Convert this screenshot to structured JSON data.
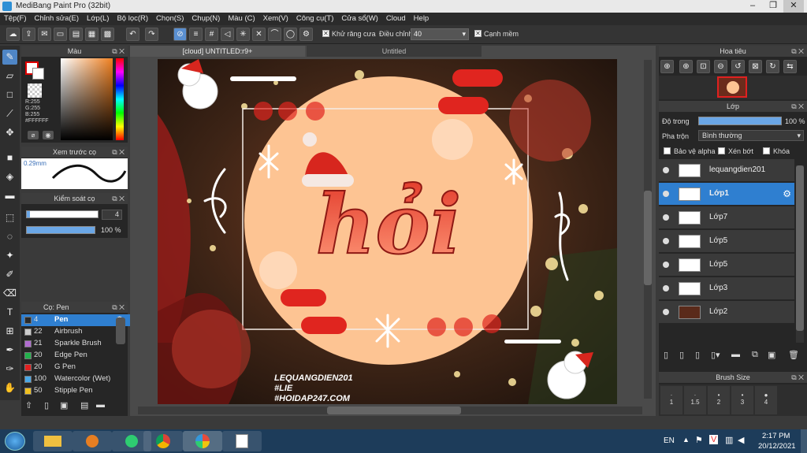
{
  "window": {
    "title": "MediBang Paint Pro (32bit)"
  },
  "menu": [
    "Tệp(F)",
    "Chỉnh sửa(E)",
    "Lớp(L)",
    "Bộ lọc(R)",
    "Chọn(S)",
    "Chụp(N)",
    "Màu (C)",
    "Xem(V)",
    "Công cụ(T)",
    "Cửa sổ(W)",
    "Cloud",
    "Help"
  ],
  "toolbar": {
    "antialias_label": "Khử răng cưa",
    "correction_label": "Điều chỉnh",
    "correction_value": "40",
    "sharp_label": "Cạnh mềm"
  },
  "color_panel": {
    "title": "Màu",
    "r": "R:255",
    "g": "G:255",
    "b": "B:255",
    "hex": "#FFFFFF"
  },
  "preview_panel": {
    "title": "Xem trước cọ",
    "size": "0.29mm"
  },
  "control_panel": {
    "title": "Kiểm soát cọ",
    "size_value": "4",
    "opacity_value": "100 %"
  },
  "brush_panel": {
    "title": "Cọ: Pen",
    "brushes": [
      {
        "size": "4",
        "name": "Pen",
        "color": "#2a2a2a"
      },
      {
        "size": "22",
        "name": "Airbrush",
        "color": "#cccccc"
      },
      {
        "size": "21",
        "name": "Sparkle Brush",
        "color": "#b06cd0"
      },
      {
        "size": "20",
        "name": "Edge Pen",
        "color": "#22b14c"
      },
      {
        "size": "20",
        "name": "G Pen",
        "color": "#e02020"
      },
      {
        "size": "100",
        "name": "Watercolor (Wet)",
        "color": "#4aa8e8"
      },
      {
        "size": "50",
        "name": "Stipple Pen",
        "color": "#f0c020"
      }
    ]
  },
  "tabs": {
    "active": "[cloud] UNTITLED:r9+",
    "other": "Untitled"
  },
  "artwork": {
    "word": "hỏi",
    "watermark": [
      "LEQUANGDIEN201",
      "#LIE",
      "#HOIDAP247.COM"
    ]
  },
  "navigator": {
    "title": "Hoa tiêu"
  },
  "layer_panel": {
    "title": "Lớp",
    "opacity_label": "Độ trong",
    "opacity_value": "100 %",
    "blend_label": "Pha trộn",
    "blend_value": "Bình thường",
    "protect_alpha": "Bảo vệ alpha",
    "clipping": "Xén bớt",
    "lock": "Khóa",
    "layers": [
      "lequangdien201",
      "Lớp1",
      "Lớp7",
      "Lớp5",
      "Lớp5",
      "Lớp3",
      "Lớp2"
    ]
  },
  "brush_size": {
    "title": "Brush Size",
    "sizes": [
      "1",
      "1.5",
      "2",
      "3",
      "4"
    ]
  },
  "taskbar": {
    "lang": "EN",
    "time": "2:17 PM",
    "date": "20/12/2021"
  }
}
